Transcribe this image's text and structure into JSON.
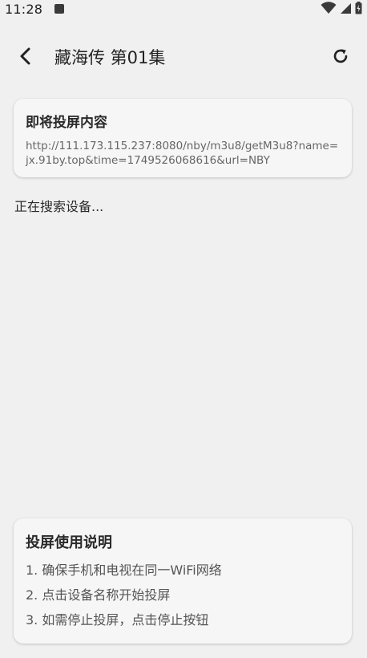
{
  "status_bar": {
    "time": "11:28"
  },
  "header": {
    "title": "藏海传 第01集",
    "back_icon": "chevron-left-icon",
    "refresh_icon": "refresh-icon"
  },
  "cast_card": {
    "title": "即将投屏内容",
    "url": "http://111.173.115.237:8080/nby/m3u8/getM3u8?name=jx.91by.top&time=1749526068616&url=NBY"
  },
  "search": {
    "status": "正在搜索设备..."
  },
  "help": {
    "title": "投屏使用说明",
    "items": [
      "1. 确保手机和电视在同一WiFi网络",
      "2. 点击设备名称开始投屏",
      "3. 如需停止投屏，点击停止按钮"
    ]
  }
}
